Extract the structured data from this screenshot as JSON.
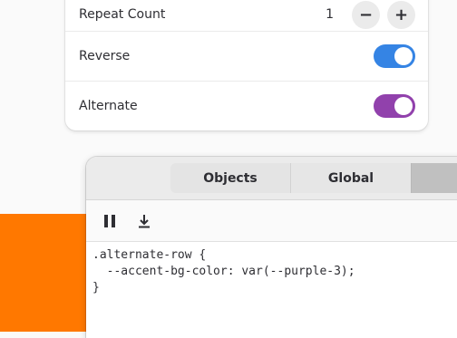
{
  "settings": {
    "repeat_count": {
      "label": "Repeat Count",
      "value": "1",
      "decrement": "−",
      "increment": "+"
    },
    "reverse": {
      "label": "Reverse",
      "enabled": true,
      "color": "#3584e4"
    },
    "alternate": {
      "label": "Alternate",
      "enabled": true,
      "color": "#9141ac"
    }
  },
  "inspector": {
    "tabs": [
      {
        "label": "Objects"
      },
      {
        "label": "Global"
      },
      {
        "label": ""
      }
    ],
    "toolbar": {
      "pause_icon": "pause-icon",
      "download_icon": "download-icon"
    },
    "code_lines": [
      ".alternate-row {",
      "  --accent-bg-color: var(--purple-3);",
      "}"
    ]
  },
  "colors": {
    "background_accent": "#ff7800"
  }
}
